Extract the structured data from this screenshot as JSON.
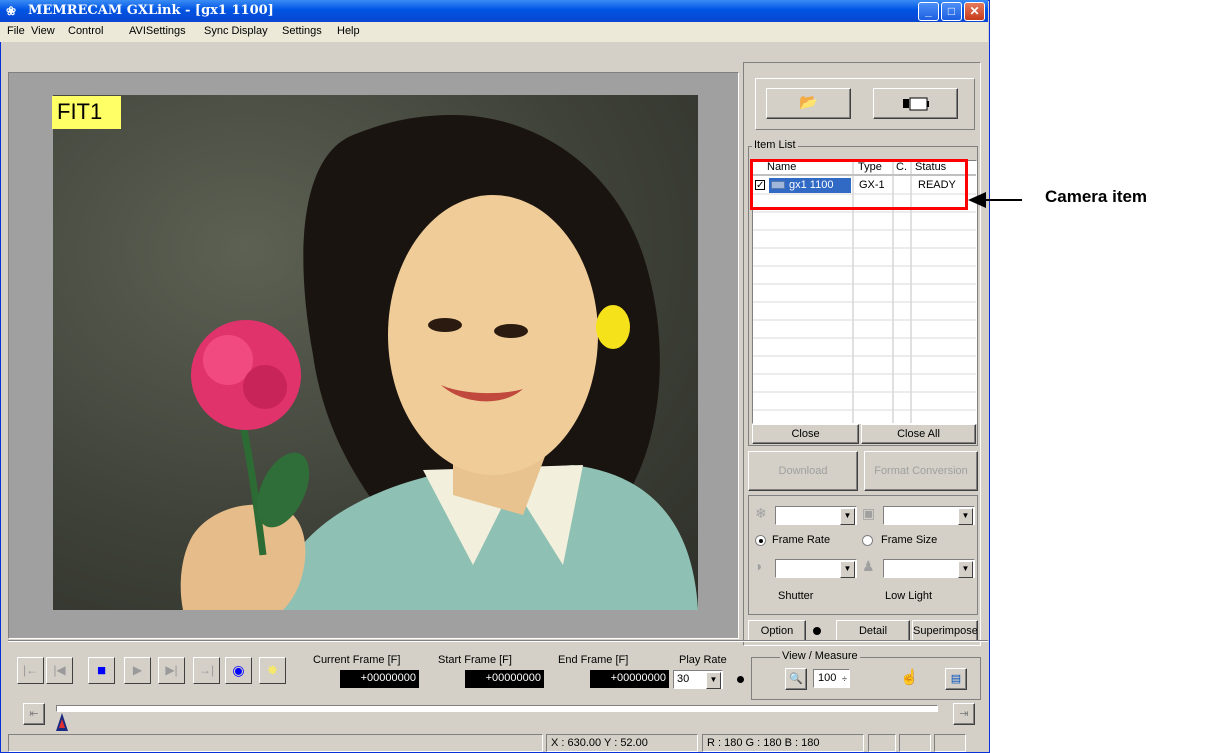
{
  "window": {
    "title": "MEMRECAM GXLink - [gx1 1100]",
    "minimize": "_",
    "maximize": "□",
    "close": "✕"
  },
  "menu": [
    "File",
    "View",
    "Control",
    "AVISettings",
    "Sync Display",
    "Settings",
    "Help"
  ],
  "viewer": {
    "fit_label": "FIT1"
  },
  "item_list": {
    "group_label": "Item List",
    "columns": [
      "Name",
      "Type",
      "C.",
      "Status"
    ],
    "rows": [
      {
        "name": "gx1 1100",
        "type": "GX-1",
        "c": "",
        "status": "READY",
        "checked": true
      }
    ],
    "close": "Close",
    "close_all": "Close All",
    "download": "Download",
    "format_conversion": "Format Conversion"
  },
  "settings": {
    "frame_rate": "Frame Rate",
    "frame_size": "Frame Size",
    "shutter": "Shutter",
    "low_light": "Low Light",
    "option": "Option",
    "detail": "Detail",
    "superimpose": "Superimpose"
  },
  "playback": {
    "current_frame_label": "Current Frame  [F]",
    "start_frame_label": "Start Frame  [F]",
    "end_frame_label": "End Frame  [F]",
    "play_rate_label": "Play Rate",
    "current_frame": "+00000000",
    "start_frame": "+00000000",
    "end_frame": "+00000000",
    "play_rate": "30"
  },
  "view_measure": {
    "label": "View / Measure",
    "zoom": "100"
  },
  "status": {
    "coords": "X : 630.00  Y : 52.00",
    "rgb": "R : 180  G : 180  B : 180"
  },
  "annotation": {
    "label": "Camera item",
    "highlight_color": "#ff0000"
  }
}
